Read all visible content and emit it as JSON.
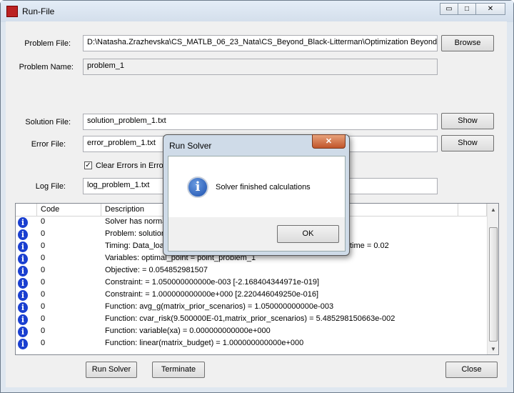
{
  "window": {
    "title": "Run-File",
    "minimize": "▭",
    "maximize": "□",
    "close": "✕"
  },
  "form": {
    "problem_file_label": "Problem File:",
    "problem_file_value": "D:\\Natasha.Zrazhevska\\CS_MATLB_06_23_Nata\\CS_Beyond_Black-Litterman\\Optimization Beyond Bl",
    "browse": "Browse",
    "problem_name_label": "Problem Name:",
    "problem_name_value": "problem_1",
    "solution_file_label": "Solution File:",
    "solution_file_value": "solution_problem_1.txt",
    "error_file_label": "Error File:",
    "error_file_value": "error_problem_1.txt",
    "show": "Show",
    "clear_errors": "Clear Errors in Error",
    "log_file_label": "Log File:",
    "log_file_value": "log_problem_1.txt"
  },
  "table": {
    "headers": [
      "",
      "Code",
      "Description",
      ""
    ],
    "rows": [
      {
        "code": "0",
        "desc": "Solver has norma"
      },
      {
        "code": "0",
        "desc": "Problem: solution"
      },
      {
        "code": "0",
        "desc": "Timing: Data_loa",
        "tail": "time = 0.02"
      },
      {
        "code": "0",
        "desc": "Variables: optimal_point = point_problem_1"
      },
      {
        "code": "0",
        "desc": "Objective:   = 0.054852981507"
      },
      {
        "code": "0",
        "desc": "Constraint:  = 1.050000000000e-003 [-2.168404344971e-019]"
      },
      {
        "code": "0",
        "desc": "Constraint:  = 1.000000000000e+000 [2.220446049250e-016]"
      },
      {
        "code": "0",
        "desc": "Function: avg_g(matrix_prior_scenarios) = 1.050000000000e-003"
      },
      {
        "code": "0",
        "desc": "Function: cvar_risk(9.500000E-01,matrix_prior_scenarios) = 5.485298150663e-002"
      },
      {
        "code": "0",
        "desc": "Function: variable(xa) = 0.000000000000e+000"
      },
      {
        "code": "0",
        "desc": "Function: linear(matrix_budget) = 1.000000000000e+000"
      }
    ]
  },
  "buttons": {
    "run_solver": "Run Solver",
    "terminate": "Terminate",
    "close": "Close"
  },
  "dialog": {
    "title": "Run Solver",
    "message": "Solver finished calculations",
    "ok": "OK",
    "close": "✕"
  }
}
